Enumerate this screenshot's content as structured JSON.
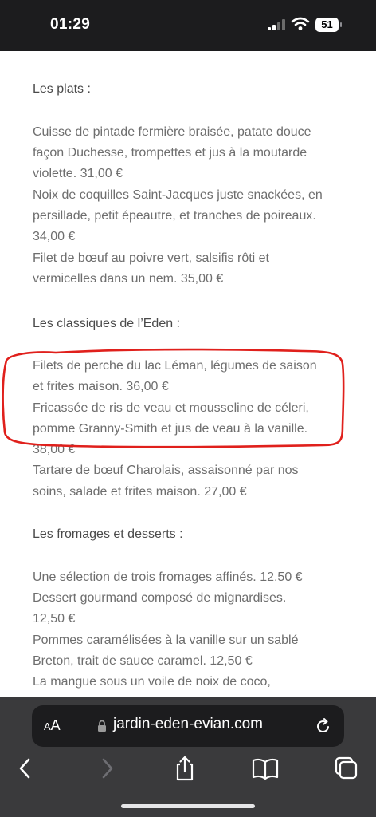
{
  "status_bar": {
    "time": "01:29",
    "battery": "51"
  },
  "menu": {
    "partial_top": "",
    "sections": {
      "plats_title": "Les plats :",
      "plats_1_a": "Cuisse de pintade fermière braisée, patate douce",
      "plats_1_b": "façon Duchesse, trompettes et jus à la moutarde",
      "plats_1_c": "violette.     31,00 €",
      "plats_2_a": "Noix de coquilles Saint-Jacques juste snackées, en",
      "plats_2_b": "persillade, petit épeautre, et tranches de poireaux.",
      "plats_2_c": "   34,00 €",
      "plats_3_a": "Filet de bœuf au poivre vert, salsifis rôti et",
      "plats_3_b": "vermicelles dans un nem.     35,00 €",
      "classiques_title": "Les classiques de l’Eden :",
      "classiques_1_a": "Filets de perche du lac Léman, légumes de saison",
      "classiques_1_b": "et frites maison.      36,00 €",
      "classiques_2_a": "Fricassée de ris de veau et mousseline de céleri,",
      "classiques_2_b": "pomme Granny-Smith et jus de veau à la vanille.",
      "classiques_2_c": "38,00 €",
      "classiques_3_a": "Tartare de bœuf Charolais, assaisonné par nos",
      "classiques_3_b": "soins, salade et frites maison.     27,00 €",
      "fromages_title": "Les fromages et desserts :",
      "fromages_1": "Une sélection de trois fromages affinés.     12,50 €",
      "fromages_2_a": "Dessert gourmand composé de mignardises.",
      "fromages_2_b": "12,50 €",
      "fromages_3_a": "Pommes caramélisées à la vanille sur un sablé",
      "fromages_3_b": "Breton, trait de sauce caramel.      12,50 €",
      "fromages_4_a": "La mangue sous un voile de noix de coco,"
    }
  },
  "browser": {
    "aa_label": "A",
    "aa_label_big": "A",
    "url": "jardin-eden-evian.com"
  },
  "colors": {
    "annotation": "#e0201c",
    "toolbar": "#3a3a3c",
    "url_bar": "#1c1c1e"
  }
}
